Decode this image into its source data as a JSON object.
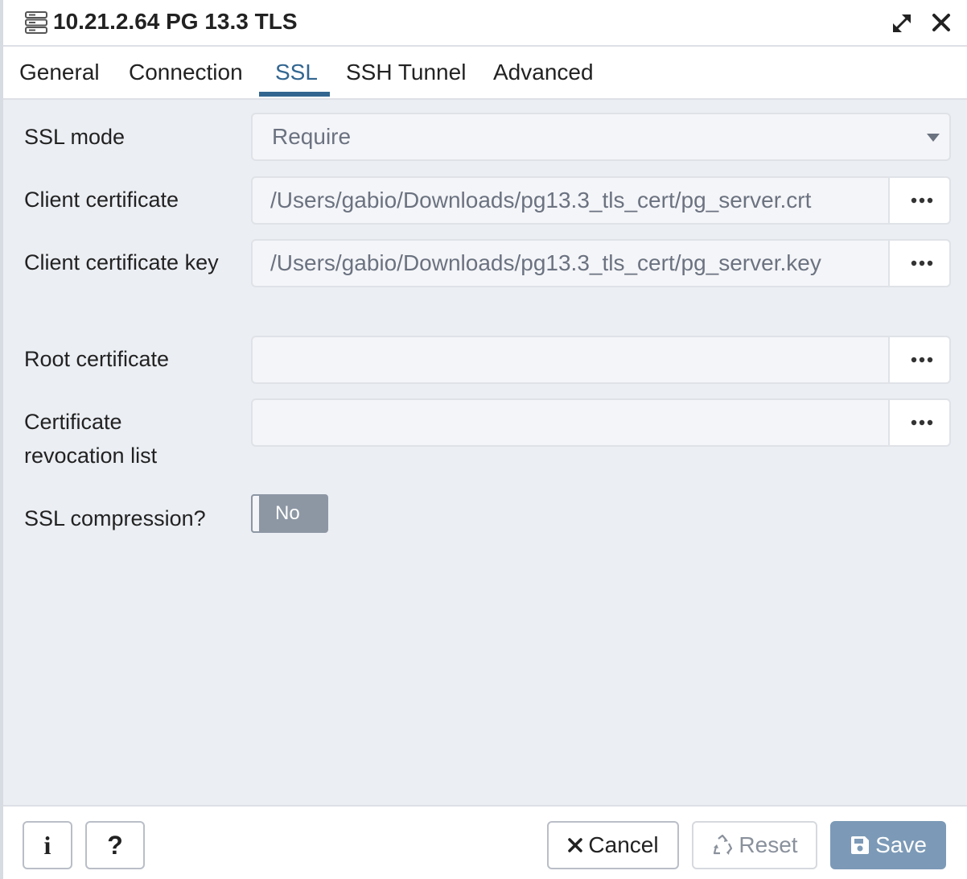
{
  "window": {
    "title": "10.21.2.64 PG 13.3 TLS",
    "title_icon": "server-icon",
    "maximize_icon": "maximize-icon",
    "close_icon": "close-icon"
  },
  "tabs": [
    {
      "label": "General",
      "active": false
    },
    {
      "label": "Connection",
      "active": false
    },
    {
      "label": "SSL",
      "active": true
    },
    {
      "label": "SSH Tunnel",
      "active": false
    },
    {
      "label": "Advanced",
      "active": false
    }
  ],
  "form": {
    "ssl_mode": {
      "label": "SSL mode",
      "value": "Require"
    },
    "client_certificate": {
      "label": "Client certificate",
      "value": "/Users/gabio/Downloads/pg13.3_tls_cert/pg_server.crt"
    },
    "client_certificate_key": {
      "label": "Client certificate key",
      "value": "/Users/gabio/Downloads/pg13.3_tls_cert/pg_server.key"
    },
    "root_certificate": {
      "label": "Root certificate",
      "value": ""
    },
    "certificate_revocation_list": {
      "label": "Certificate revocation list",
      "value": ""
    },
    "ssl_compression": {
      "label": "SSL compression?",
      "value": "No"
    },
    "browse_icon": "more-icon"
  },
  "footer": {
    "info_label": "i",
    "help_label": "?",
    "cancel_label": "Cancel",
    "reset_label": "Reset",
    "save_label": "Save"
  },
  "colors": {
    "accent": "#326690",
    "content_bg": "#ebeef3",
    "toggle_off": "#8d97a4",
    "save_button": "#7c9ab7"
  }
}
